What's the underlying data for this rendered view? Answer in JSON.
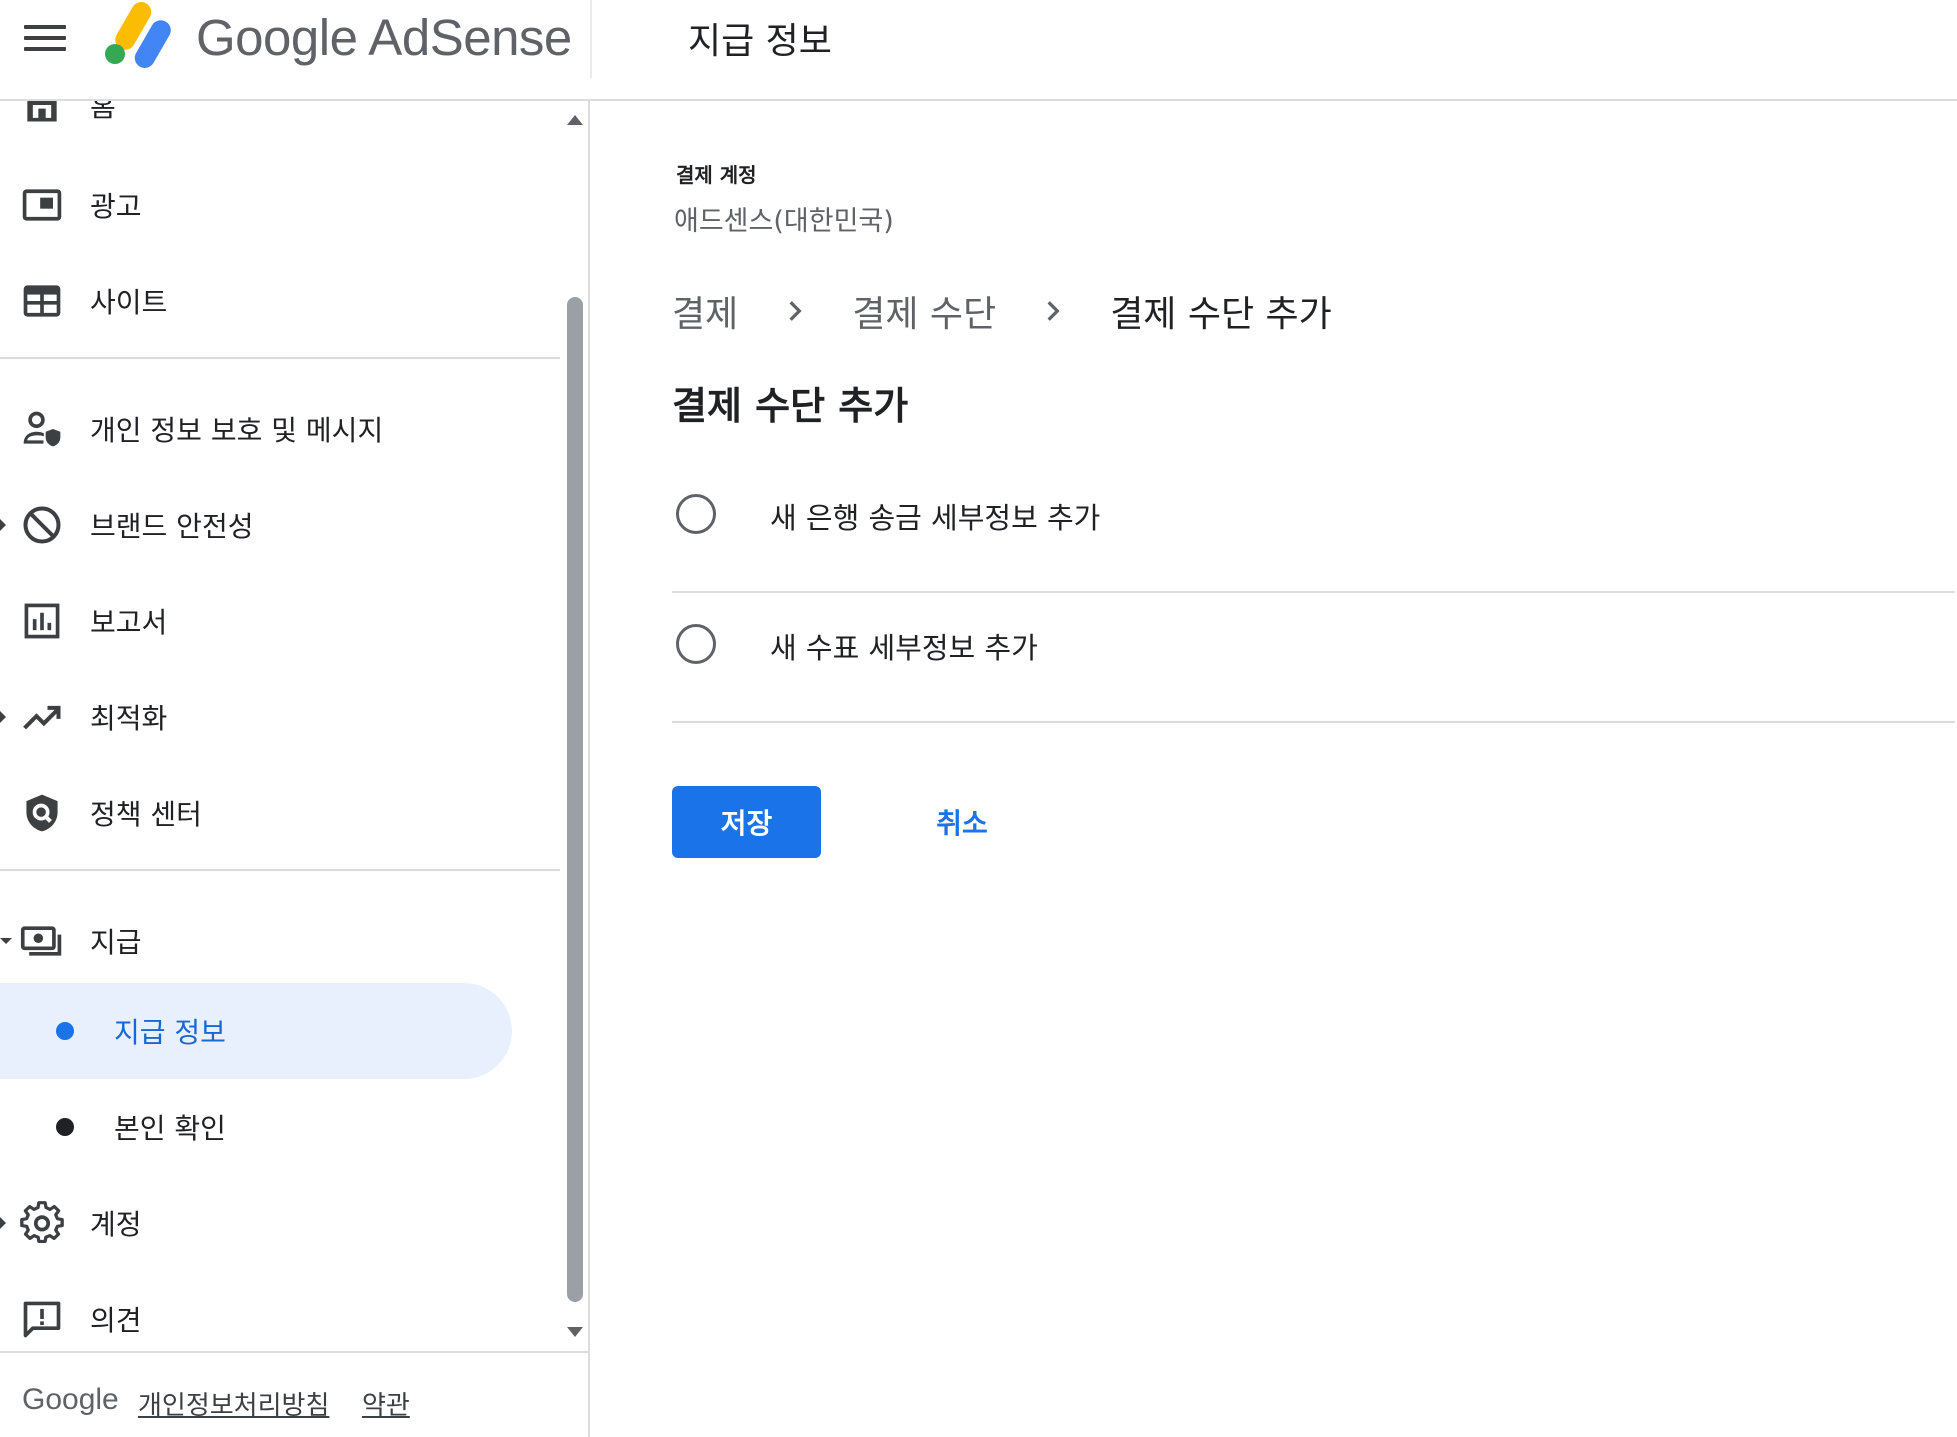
{
  "header": {
    "brand": "Google AdSense",
    "page_title": "지급 정보"
  },
  "sidebar": {
    "items": [
      {
        "label": "홈",
        "icon": "home-icon"
      },
      {
        "label": "광고",
        "icon": "ads-icon"
      },
      {
        "label": "사이트",
        "icon": "sites-icon"
      },
      {
        "label": "개인 정보 보호 및 메시지",
        "icon": "privacy-messaging-icon"
      },
      {
        "label": "브랜드 안전성",
        "icon": "block-icon",
        "expandable": true
      },
      {
        "label": "보고서",
        "icon": "reports-icon"
      },
      {
        "label": "최적화",
        "icon": "trending-up-icon",
        "expandable": true
      },
      {
        "label": "정책 센터",
        "icon": "policy-shield-icon"
      },
      {
        "label": "지급",
        "icon": "payments-icon",
        "expanded": true
      },
      {
        "label": "계정",
        "icon": "gear-icon",
        "expandable": true
      },
      {
        "label": "의견",
        "icon": "feedback-icon"
      }
    ],
    "sub_items": [
      {
        "label": "지급 정보",
        "active": true
      },
      {
        "label": "본인 확인",
        "active": false
      }
    ]
  },
  "footer": {
    "google": "Google",
    "privacy": "개인정보처리방침",
    "terms": "약관"
  },
  "main": {
    "account_label": "결제 계정",
    "account_value": "애드센스(대한민국)",
    "breadcrumb": [
      "결제",
      "결제 수단",
      "결제 수단 추가"
    ],
    "section_title": "결제 수단 추가",
    "options": [
      {
        "label": "새 은행 송금 세부정보 추가",
        "selected": false
      },
      {
        "label": "새 수표 세부정보 추가",
        "selected": false
      }
    ],
    "save_label": "저장",
    "cancel_label": "취소"
  },
  "colors": {
    "primary": "#1a73e8",
    "active_bg": "#e8f0fe",
    "divider": "#dadce0",
    "text": "#202124",
    "muted": "#5f6368"
  }
}
